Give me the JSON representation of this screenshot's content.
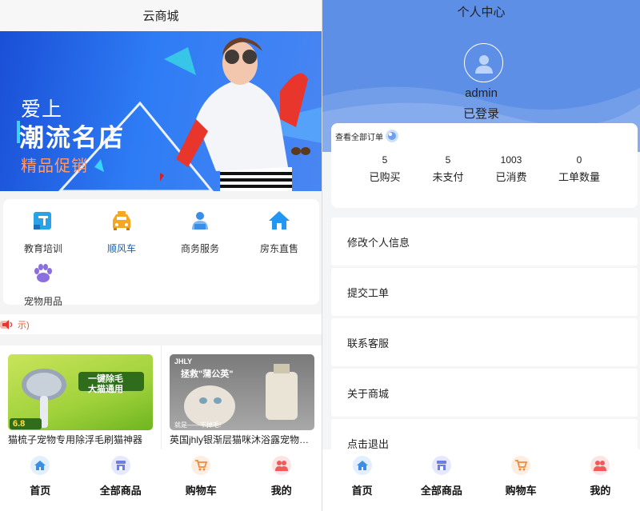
{
  "left": {
    "header_title": "云商城",
    "banner": {
      "line1": "爱上",
      "line2": "潮流名店",
      "line3": "精品促销"
    },
    "categories": [
      {
        "label": "教育培训",
        "icon": "education-icon",
        "color": "#29a3e8"
      },
      {
        "label": "顺风车",
        "icon": "taxi-icon",
        "color": "#f5a623",
        "active": true
      },
      {
        "label": "商务服务",
        "icon": "business-person-icon",
        "color": "#3a8ee6"
      },
      {
        "label": "房东直售",
        "icon": "house-icon",
        "color": "#2196f3"
      },
      {
        "label": "宠物用品",
        "icon": "paw-icon",
        "color": "#8b6fe0"
      }
    ],
    "notice": "示)",
    "products": [
      {
        "name": "猫梳子宠物专用除浮毛刷猫神器",
        "img_lines": [
          "一键除毛",
          "大猫通用",
          "6.8"
        ]
      },
      {
        "name": "英国jhly银渐层猫咪沐浴露宠物除臭",
        "img_lines": [
          "JHLY",
          "拯救\"蒲公英\"",
          "就是——不掉毛!"
        ]
      }
    ]
  },
  "right": {
    "title": "个人中心",
    "username": "admin",
    "status": "已登录",
    "orders_head": "查看全部订单",
    "stats": [
      {
        "num": "5",
        "label": "已购买"
      },
      {
        "num": "5",
        "label": "未支付"
      },
      {
        "num": "1003",
        "label": "已消费"
      },
      {
        "num": "0",
        "label": "工单数量"
      }
    ],
    "menu": [
      "修改个人信息",
      "提交工单",
      "联系客服",
      "关于商城",
      "点击退出"
    ]
  },
  "tabbar": [
    {
      "label": "首页",
      "icon": "home-icon",
      "color": "#3a8ee6"
    },
    {
      "label": "全部商品",
      "icon": "shop-icon",
      "color": "#6c7ee1"
    },
    {
      "label": "购物车",
      "icon": "cart-icon",
      "color": "#f08b3c"
    },
    {
      "label": "我的",
      "icon": "user-group-icon",
      "color": "#f05a5a"
    }
  ]
}
